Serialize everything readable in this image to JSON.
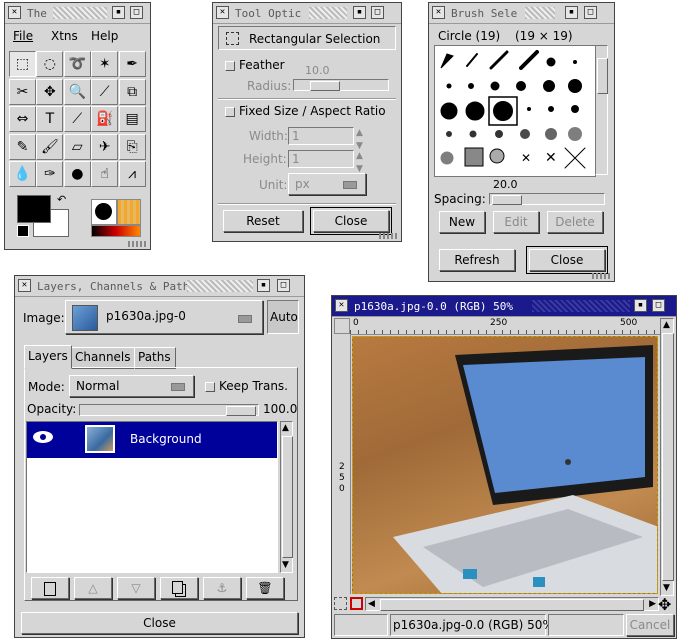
{
  "toolbox": {
    "title": "The",
    "menu": [
      "File",
      "Xtns",
      "Help"
    ],
    "tool_icons": [
      "rect-select-icon",
      "ellipse-select-icon",
      "lasso-icon",
      "magic-wand-icon",
      "bezier-select-icon",
      "scissors-icon",
      "move-icon",
      "magnify-icon",
      "crop-icon",
      "transform-icon",
      "flip-icon",
      "text-icon",
      "color-picker-icon",
      "bucket-fill-icon",
      "gradient-icon",
      "pencil-icon",
      "paintbrush-icon",
      "eraser-icon",
      "airbrush-icon",
      "clone-icon",
      "convolve-icon",
      "ink-icon",
      "dodge-burn-icon",
      "smudge-icon",
      "measure-icon"
    ],
    "fg_color": "#000000",
    "bg_color": "#ffffff"
  },
  "tool_options": {
    "title": "Tool Optic",
    "heading": "Rectangular Selection",
    "feather_label": "Feather",
    "radius_label": "Radius:",
    "radius_value": "10.0",
    "fixed_label": "Fixed Size / Aspect Ratio",
    "width_label": "Width:",
    "width_value": "1",
    "height_label": "Height:",
    "height_value": "1",
    "unit_label": "Unit:",
    "unit_value": "px",
    "reset_label": "Reset",
    "close_label": "Close"
  },
  "brushes": {
    "title": "Brush Sele",
    "brush_name": "Circle (19)",
    "brush_size": "(19 × 19)",
    "spacing_value": "20.0",
    "spacing_label": "Spacing:",
    "new_label": "New",
    "edit_label": "Edit",
    "delete_label": "Delete",
    "refresh_label": "Refresh",
    "close_label": "Close"
  },
  "layers": {
    "title": "Layers, Channels & Paths",
    "image_label": "Image:",
    "image_value": "p1630a.jpg-0",
    "auto_label": "Auto",
    "tabs": [
      "Layers",
      "Channels",
      "Paths"
    ],
    "mode_label": "Mode:",
    "mode_value": "Normal",
    "keep_trans_label": "Keep Trans.",
    "opacity_label": "Opacity:",
    "opacity_value": "100.0",
    "layer_name": "Background",
    "close_label": "Close"
  },
  "image_window": {
    "title": "p1630a.jpg-0.0 (RGB) 50%",
    "ruler_ticks": [
      "0",
      "250",
      "500"
    ],
    "vruler_ticks": [
      "2",
      "5",
      "0"
    ],
    "status": "p1630a.jpg-0.0 (RGB) 50%",
    "cancel_label": "Cancel"
  },
  "colors": {
    "window_bg": "#d6d6d6",
    "selection_blue": "#00009a",
    "active_title": "#1a1a8c"
  }
}
